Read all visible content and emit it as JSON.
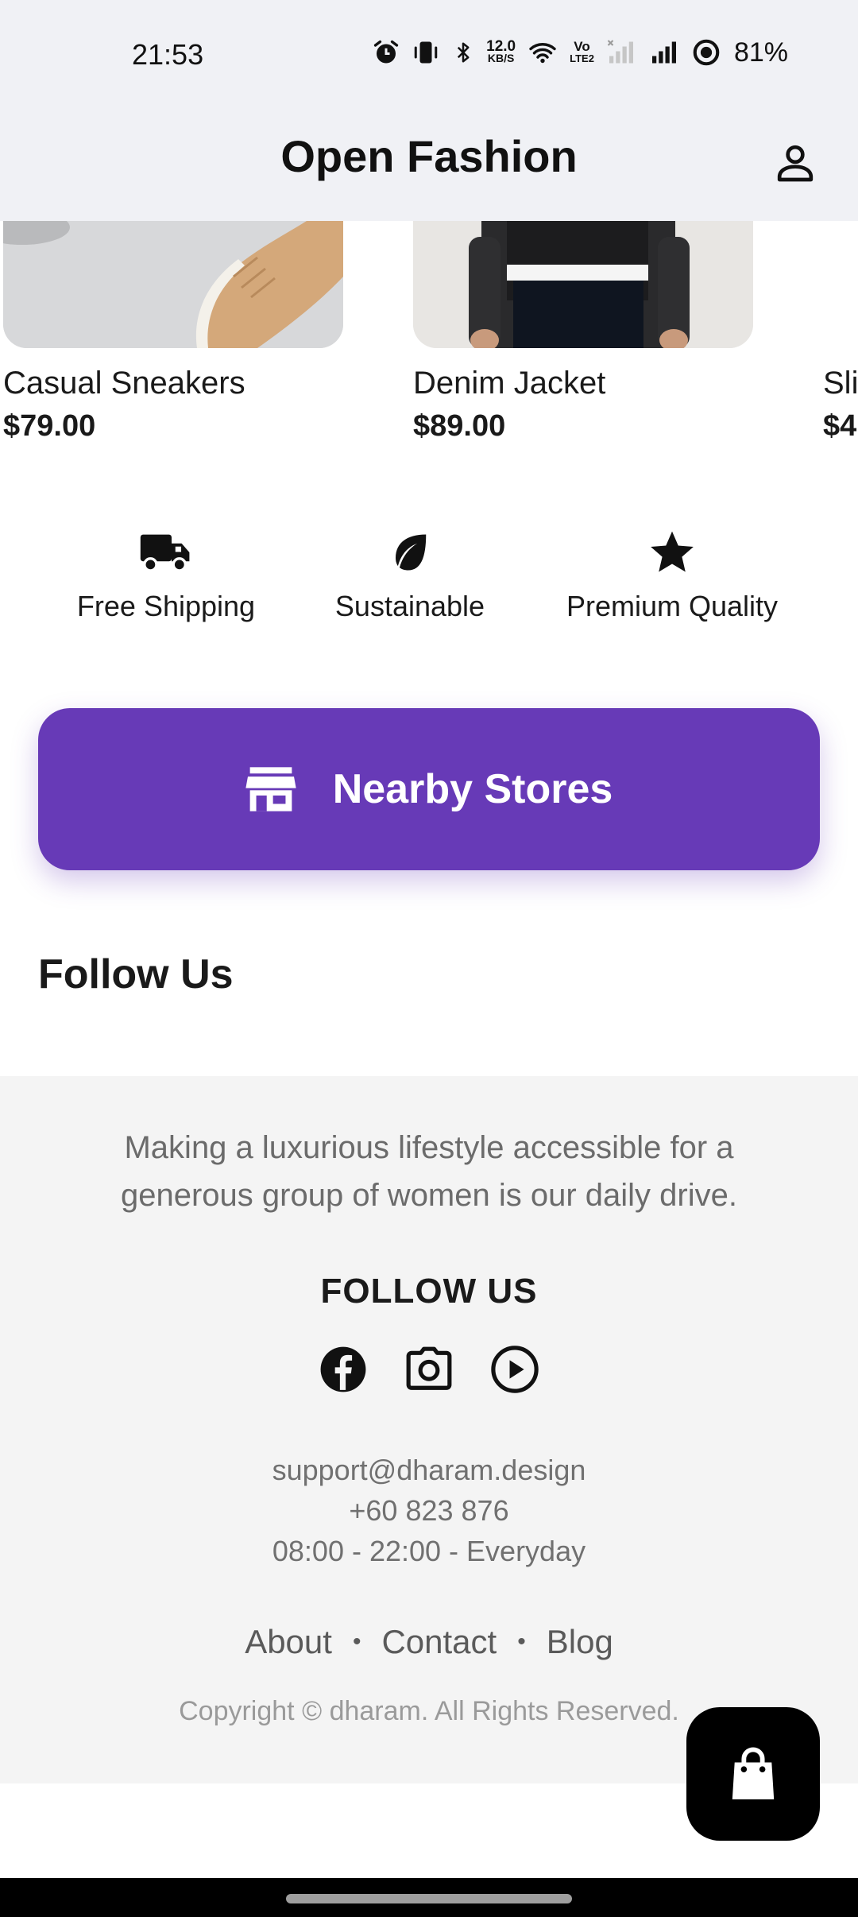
{
  "status_bar": {
    "time": "21:53",
    "net_speed_value": "12.0",
    "net_speed_unit": "KB/S",
    "volte_top": "Vo",
    "volte_bottom": "LTE2",
    "battery": "81%",
    "icons": [
      "alarm-icon",
      "vibrate-icon",
      "bluetooth-icon",
      "wifi-icon",
      "volte-icon",
      "signal-sim1-icon",
      "signal-sim2-icon",
      "battery-saver-icon"
    ]
  },
  "app_bar": {
    "title": "Open Fashion",
    "profile_icon": "user-icon"
  },
  "products": [
    {
      "name": "Casual Sneakers",
      "price": "$79.00"
    },
    {
      "name": "Denim Jacket",
      "price": "$89.00"
    },
    {
      "name": "Sli",
      "price": "$4"
    }
  ],
  "features": [
    {
      "label": "Free Shipping",
      "icon": "truck-icon"
    },
    {
      "label": "Sustainable",
      "icon": "leaf-icon"
    },
    {
      "label": "Premium Quality",
      "icon": "star-icon"
    }
  ],
  "nearby_stores": {
    "label": "Nearby Stores",
    "icon": "store-icon",
    "color": "#673ab7"
  },
  "follow_section": {
    "heading": "Follow Us"
  },
  "footer": {
    "tagline": "Making a luxurious lifestyle accessible for a generous group of women is our daily drive.",
    "follow_title": "FOLLOW US",
    "socials": [
      "facebook-icon",
      "camera-icon",
      "play-icon"
    ],
    "email": "support@dharam.design",
    "phone": "+60 823 876",
    "hours": "08:00 - 22:00 - Everyday",
    "links": [
      "About",
      "Contact",
      "Blog"
    ],
    "link_separator": "•",
    "copyright": "Copyright © dharam. All Rights Reserved."
  },
  "cart": {
    "icon": "shopping-bag-icon"
  }
}
